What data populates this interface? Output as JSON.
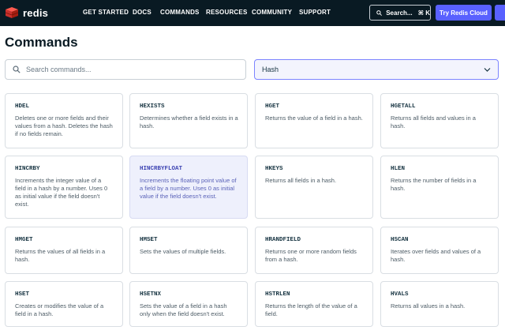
{
  "brand": {
    "name": "redis"
  },
  "nav": {
    "items": [
      "GET STARTED",
      "DOCS",
      "COMMANDS",
      "RESOURCES",
      "COMMUNITY",
      "SUPPORT"
    ],
    "search_label": "Search...",
    "search_shortcut": "⌘ K",
    "cta_label": "Try Redis Cloud"
  },
  "page": {
    "title": "Commands"
  },
  "filters": {
    "search_placeholder": "Search commands...",
    "search_value": "",
    "group_selected": "Hash"
  },
  "commands": [
    {
      "name": "HDEL",
      "desc": "Deletes one or more fields and their values from a hash. Deletes the hash if no fields remain."
    },
    {
      "name": "HEXISTS",
      "desc": "Determines whether a field exists in a hash."
    },
    {
      "name": "HGET",
      "desc": "Returns the value of a field in a hash."
    },
    {
      "name": "HGETALL",
      "desc": "Returns all fields and values in a hash."
    },
    {
      "name": "HINCRBY",
      "desc": "Increments the integer value of a field in a hash by a number. Uses 0 as initial value if the field doesn't exist."
    },
    {
      "name": "HINCRBYFLOAT",
      "desc": "Increments the floating point value of a field by a number. Uses 0 as initial value if the field doesn't exist."
    },
    {
      "name": "HKEYS",
      "desc": "Returns all fields in a hash."
    },
    {
      "name": "HLEN",
      "desc": "Returns the number of fields in a hash."
    },
    {
      "name": "HMGET",
      "desc": "Returns the values of all fields in a hash."
    },
    {
      "name": "HMSET",
      "desc": "Sets the values of multiple fields."
    },
    {
      "name": "HRANDFIELD",
      "desc": "Returns one or more random fields from a hash."
    },
    {
      "name": "HSCAN",
      "desc": "Iterates over fields and values of a hash."
    },
    {
      "name": "HSET",
      "desc": "Creates or modifies the value of a field in a hash."
    },
    {
      "name": "HSETNX",
      "desc": "Sets the value of a field in a hash only when the field doesn't exist."
    },
    {
      "name": "HSTRLEN",
      "desc": "Returns the length of the value of a field."
    },
    {
      "name": "HVALS",
      "desc": "Returns all values in a hash."
    }
  ],
  "colors": {
    "nav_bg": "#091a23",
    "accent": "#5961ff",
    "brand_red": "#dc382c",
    "highlight_card": "#eef0fc"
  }
}
